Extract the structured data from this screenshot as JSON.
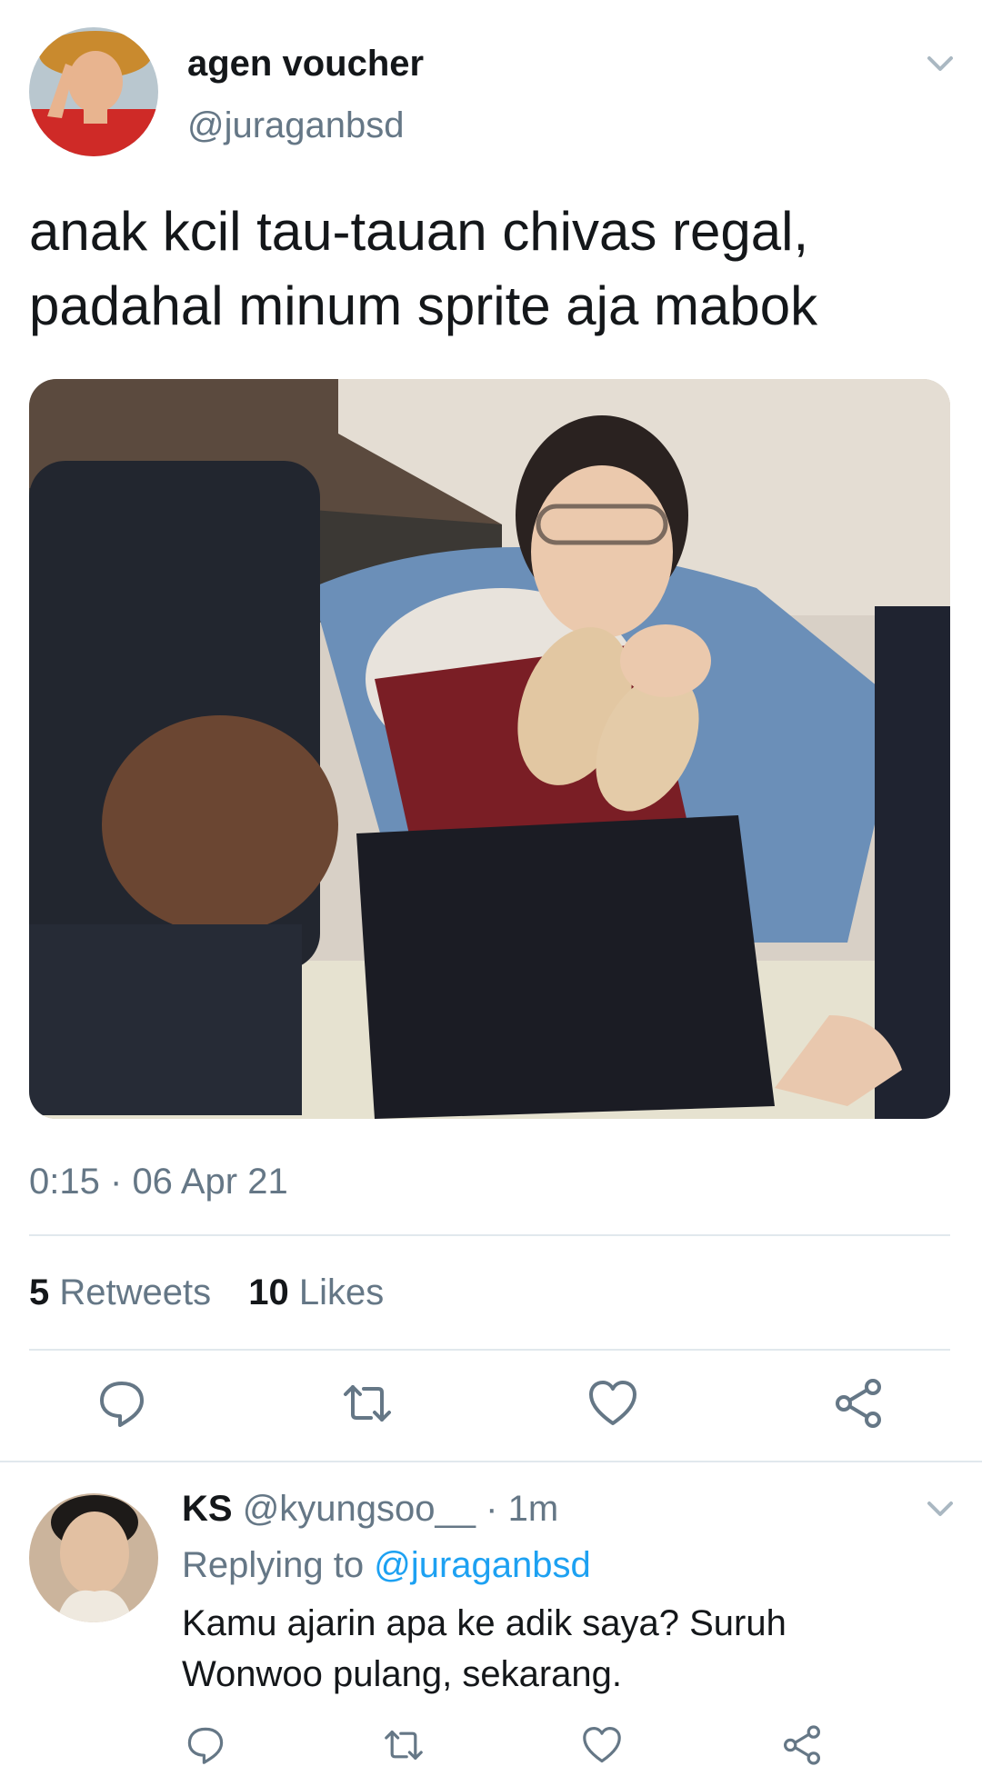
{
  "tweet": {
    "author_name": "agen voucher",
    "author_handle": "@juraganbsd",
    "text_lines": [
      "anak kcil tau-tauan chivas regal,",
      "padahal minum sprite aja mabok"
    ],
    "time": "0:15",
    "separator": "·",
    "date": "06 Apr 21",
    "retweets_count": "5",
    "retweets_label": "Retweets",
    "likes_count": "10",
    "likes_label": "Likes"
  },
  "reply": {
    "author_name": "KS",
    "author_handle": "@kyungsoo__",
    "time_ago": "· 1m",
    "replying_label": "Replying to",
    "replying_to": "@juraganbsd",
    "text_lines": [
      "Kamu ajarin apa ke adik saya? Suruh",
      "Wonwoo pulang, sekarang."
    ]
  },
  "icons": {
    "reply": "reply-icon",
    "retweet": "retweet-icon",
    "like": "heart-icon",
    "share": "share-icon",
    "more": "chevron-down-icon"
  },
  "colors": {
    "text_primary": "#14171a",
    "text_secondary": "#657786",
    "link": "#1da1f2",
    "divider": "#e1e8ed",
    "icon": "#657786"
  }
}
